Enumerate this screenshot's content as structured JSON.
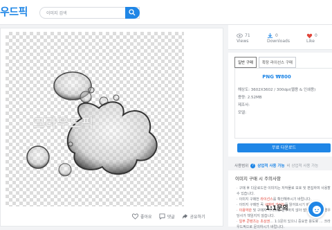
{
  "header": {
    "logo": "우드픽",
    "search_placeholder": "이미지 검색",
    "search_icon": "search-icon"
  },
  "preview": {
    "watermark": "크라우드픽"
  },
  "actions": {
    "like": "좋아요",
    "comment": "댓글",
    "share": "공유하기"
  },
  "stats": {
    "views": {
      "count": "71",
      "label": "Views"
    },
    "downloads": {
      "count": "0",
      "label": "Downloads"
    },
    "likes": {
      "count": "0",
      "label": "Like"
    }
  },
  "purchase": {
    "tabs": [
      "일반 구매",
      "확장 라이선스 구매"
    ],
    "price": "PNG ₩800",
    "resolution": "해상도: 3602X3602 / 300dpi(웹용 & 인쇄용)",
    "size": "용량: 2.52MB",
    "maker": "제조사:",
    "model": "모델:",
    "download_btn": "무료 다운로드",
    "scope_label": "사용범위",
    "scope_value": "상업적 사용 가능",
    "scope_other": "비 상업적 사용 가능"
  },
  "notice": {
    "title": "이미지 구매 시 주의사항",
    "items": [
      {
        "pre": "구매 후 다운로드한 이미지는 저작물로 보호 및 편집하여 사용할 수 있습니다.",
        "red": "",
        "post": ""
      },
      {
        "pre": "이미지 구매전 ",
        "red": "라이선스",
        "post": "를 확인해주시기 바랍니다."
      },
      {
        "pre": "이미지 구매전 꼭 ",
        "red": "구매자 가이드",
        "post": "를 읽어보시기 바랍니다."
      },
      {
        "pre": "",
        "red": "이용약관",
        "post": " 및 구매자 가이드를 준수하지 않아 발생한 문제의 경우 당사가 책임지지 않습니다."
      },
      {
        "pre": "",
        "red": "일부 콘텐츠는 초상권",
        "post": "… 1:1문의 있으니 중요한 용도로 … 크라우드픽으로 문의하시기 바랍니다."
      }
    ]
  },
  "chat": {
    "label": "1:1문의"
  }
}
